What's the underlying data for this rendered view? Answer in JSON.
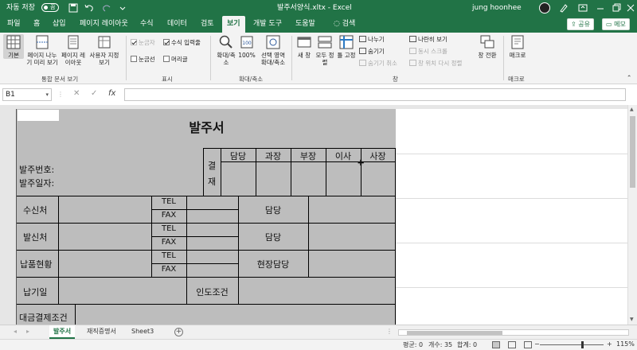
{
  "titlebar": {
    "autosave_label": "자동 저장",
    "autosave_state": "끔",
    "filename": "발주서양식.xltx - Excel",
    "search_placeholder": "검색",
    "user": "jung hoonhee",
    "accent": "#217346"
  },
  "tabs": [
    "파일",
    "홈",
    "삽입",
    "페이지 레이아웃",
    "수식",
    "데이터",
    "검토",
    "보기",
    "개발 도구",
    "도움말"
  ],
  "active_tab": "보기",
  "tell_me": "검색",
  "share_label": "공유",
  "memo_label": "메모",
  "ribbon": {
    "workbook_views": {
      "label": "통합 문서 보기",
      "buttons": [
        "기본",
        "페이지 나누기 미리 보기",
        "페이지 레이아웃",
        "사용자 지정 보기"
      ]
    },
    "show": {
      "label": "표시",
      "ruler": "눈금자",
      "formula_bar": "수식 입력줄",
      "gridlines": "눈금선",
      "headings": "머리글"
    },
    "zoom": {
      "label": "확대/축소",
      "zoom_btn": "확대/축소",
      "hundred_btn": "100%",
      "selection_btn": "선택 영역 확대/축소"
    },
    "window": {
      "label": "창",
      "new_window": "새 창",
      "arrange_all": "모두 정렬",
      "freeze_panes": "틀 고정",
      "split": "나누기",
      "hide": "숨기기",
      "unhide": "숨기기 취소",
      "side_by_side": "나란히 보기",
      "sync_scroll": "동시 스크롤",
      "reset_position": "창 위치 다시 정렬",
      "switch_windows": "창 전환"
    },
    "macros": {
      "label": "매크로",
      "macros_btn": "매크로"
    }
  },
  "formula_bar": {
    "name_box": "B1",
    "fx": "fx",
    "content": ""
  },
  "form": {
    "title": "발주서",
    "order_no": "발주번호:",
    "order_date": "발주일자:",
    "approval": [
      "결",
      "재"
    ],
    "approval_cols": [
      "담당",
      "과장",
      "부장",
      "이사",
      "사장"
    ],
    "rows": {
      "receiver": "수신처",
      "sender": "발신처",
      "delivery": "납품현황",
      "due_date": "납기일",
      "handover": "인도조건",
      "payment": "대금결제조건",
      "tel": "TEL",
      "fax": "FAX",
      "contact": "담당",
      "site_contact": "현장담당"
    }
  },
  "sheets": [
    "발주서",
    "재직증명서",
    "Sheet3"
  ],
  "active_sheet": "발주서",
  "status": {
    "average": "평균: 0",
    "count": "개수: 35",
    "sum": "합계: 0",
    "zoom": "115%"
  }
}
